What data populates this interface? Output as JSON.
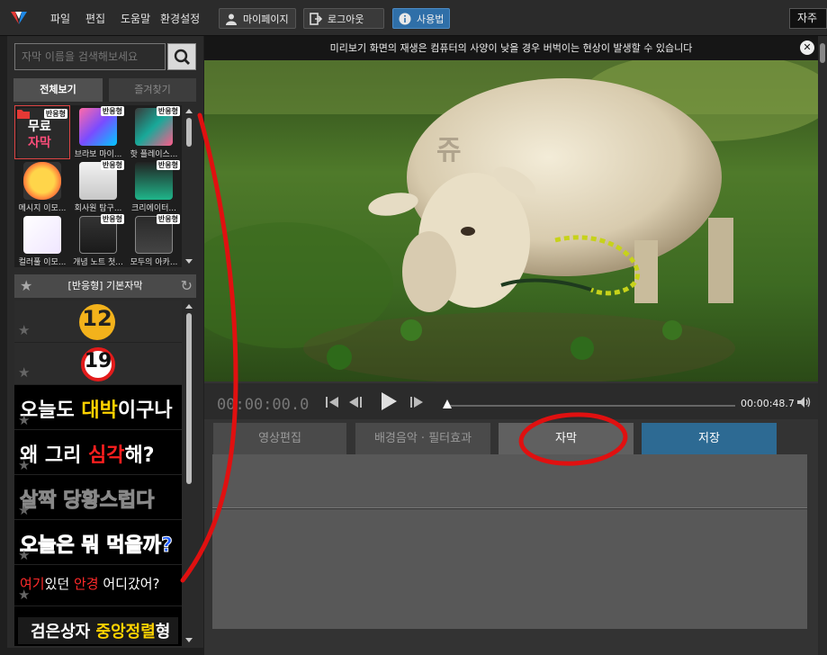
{
  "menubar": {
    "menu": [
      "파일",
      "편집",
      "도움말",
      "환경설정"
    ],
    "buttons": {
      "mypage": "마이페이지",
      "logout": "로그아웃",
      "howto": "사용법"
    },
    "right_label": "자주"
  },
  "sidebar": {
    "search_placeholder": "자막 이름을 검색해보세요",
    "tabs": {
      "all": "전체보기",
      "favorites": "즐겨찾기"
    },
    "thumbnails": [
      {
        "badge": "반응형",
        "label": "",
        "text_a": "무료",
        "text_b": "자막"
      },
      {
        "badge": "반응형",
        "label": "브라보 마이..."
      },
      {
        "badge": "반응형",
        "label": "핫 플레이스..."
      },
      {
        "badge": "",
        "label": "메시지 이모..."
      },
      {
        "badge": "반응형",
        "label": "회사원 탐구..."
      },
      {
        "badge": "반응형",
        "label": "크리에이터..."
      },
      {
        "badge": "",
        "label": "컬러풀 이모..."
      },
      {
        "badge": "반응형",
        "label": "개념 노트 첫..."
      },
      {
        "badge": "반응형",
        "label": "모두의 아카..."
      }
    ],
    "preset_header": "[반응형] 기본자막",
    "presets": {
      "p1_num": "12",
      "p2_num": "19",
      "p3": {
        "a": "오늘도 ",
        "b": "대박",
        "c": "이구나"
      },
      "p4": {
        "a": "왜 그리 ",
        "b": "심각",
        "c": "해?"
      },
      "p5": "살짝 당황스럽다",
      "p6": "오늘은 뭐 먹을까?",
      "p7": {
        "a": "여기",
        "b": "있던 ",
        "c": "안경",
        "d": " 어디갔어?"
      },
      "p8": {
        "a": "검은상자 ",
        "b": "중앙정렬",
        "c": "형"
      }
    }
  },
  "preview": {
    "notice": "미리보기 화면의 재생은 컴퓨터의 사양이 낮을 경우 버벅이는 현상이 발생할 수 있습니다",
    "watermark": "쥬",
    "current_time": "00:00:00.0",
    "end_time": "00:00:48.7"
  },
  "editor": {
    "tabs": {
      "video": "영상편집",
      "music": "배경음악 · 필터효과",
      "subtitle": "자막",
      "save": "저장"
    }
  },
  "colors": {
    "annotation": "#e01010",
    "accent_blue": "#2d6a93",
    "highlight_yellow": "#ffd200"
  }
}
